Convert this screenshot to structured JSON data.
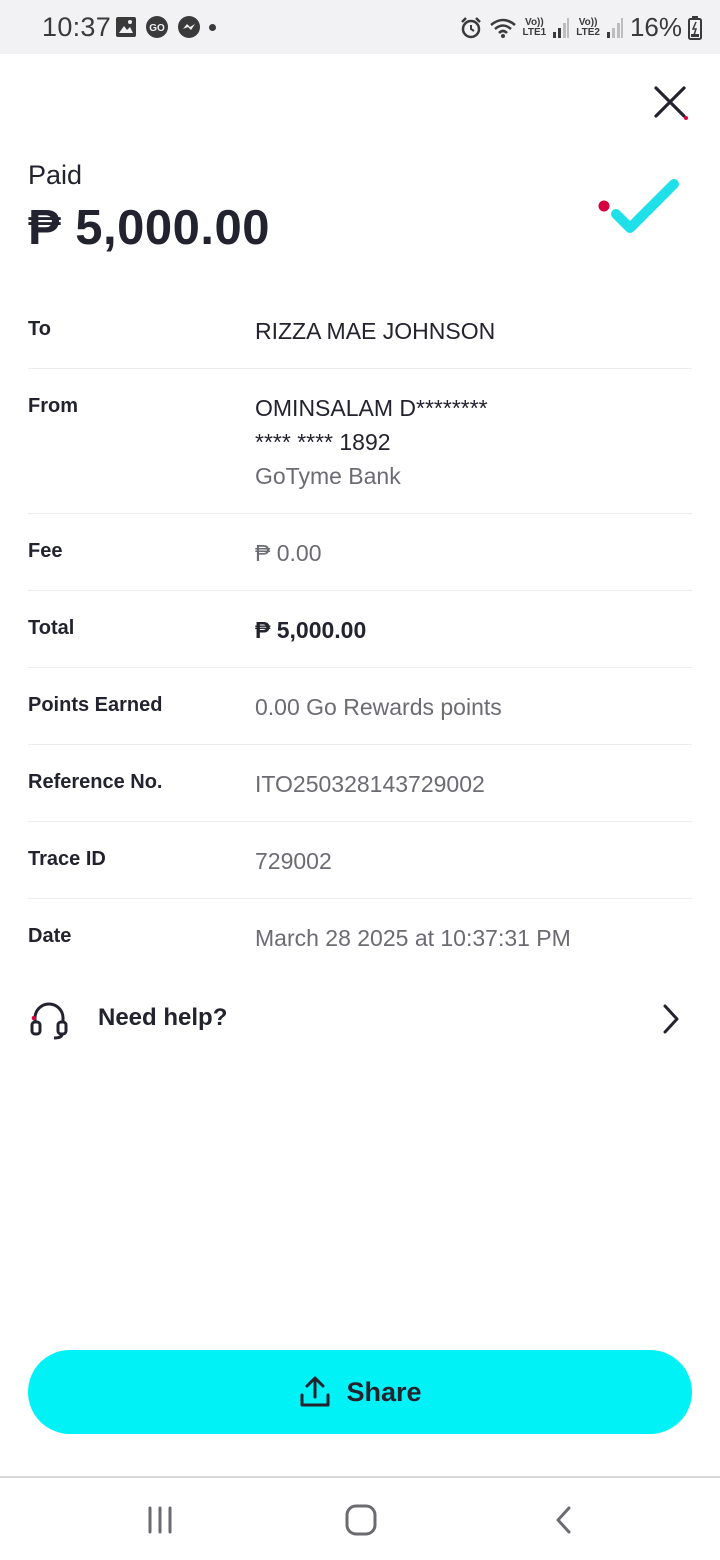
{
  "status_bar": {
    "time": "10:37",
    "battery": "16%",
    "lte1": "LTE1",
    "lte2": "LTE2",
    "volte": "Vo))",
    "icons": [
      "gallery-icon",
      "go-app-icon",
      "messenger-icon",
      "dot-icon",
      "alarm-icon",
      "wifi-icon",
      "signal-icon",
      "battery-icon"
    ]
  },
  "header": {
    "status_label": "Paid",
    "amount": "₱ 5,000.00"
  },
  "details": [
    {
      "label": "To",
      "value": "RIZZA MAE JOHNSON"
    },
    {
      "label": "From",
      "value_lines": [
        "OMINSALAM D********",
        "**** **** 1892",
        "GoTyme Bank"
      ]
    },
    {
      "label": "Fee",
      "value": "₱ 0.00"
    },
    {
      "label": "Total",
      "value": "₱ 5,000.00"
    },
    {
      "label": "Points Earned",
      "value": "0.00 Go Rewards points"
    },
    {
      "label": "Reference No.",
      "value": "ITO250328143729002"
    },
    {
      "label": "Trace ID",
      "value": "729002"
    },
    {
      "label": "Date",
      "value": "March 28 2025 at 10:37:31 PM"
    }
  ],
  "help": {
    "label": "Need help?"
  },
  "share": {
    "label": "Share"
  },
  "colors": {
    "accent": "#00f1f6",
    "check": "#1fe0e8",
    "dot": "#d6003f",
    "text": "#23232f",
    "muted": "#6b6b72"
  }
}
